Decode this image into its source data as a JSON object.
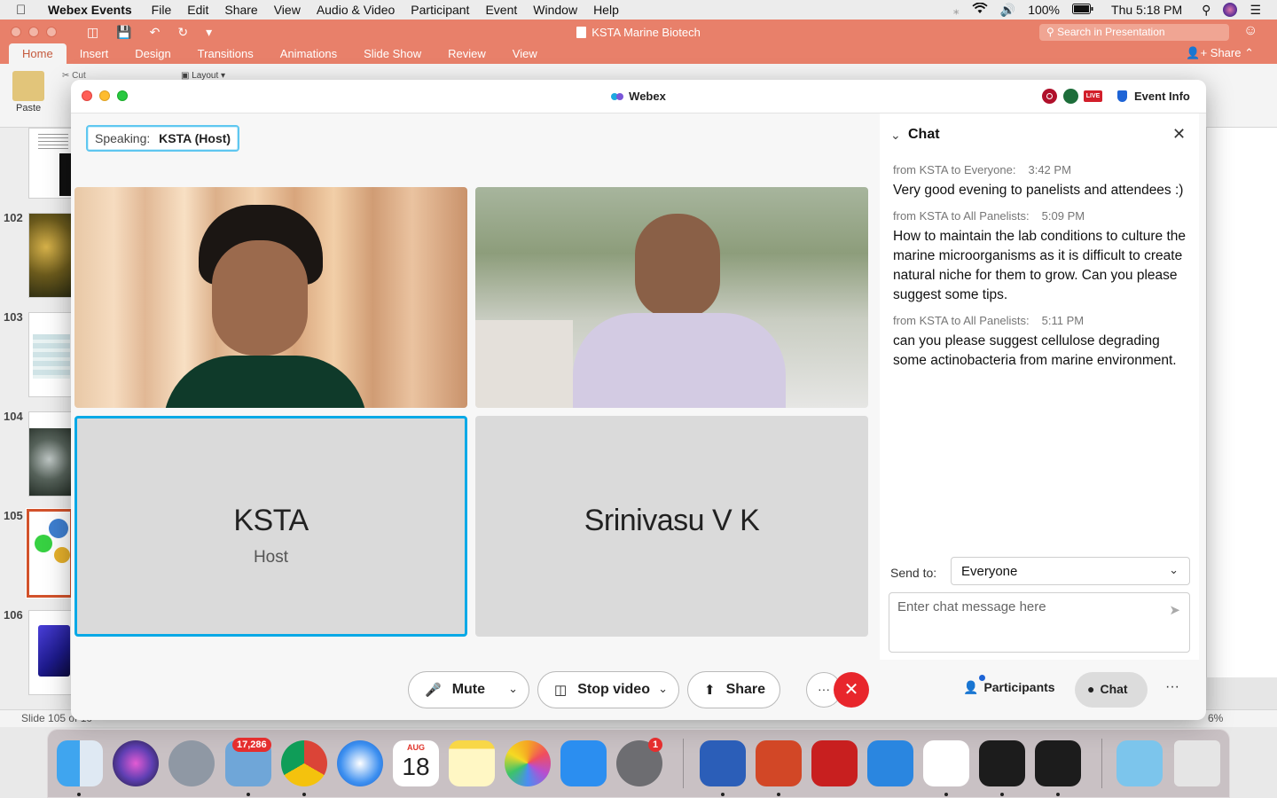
{
  "menubar": {
    "app_name": "Webex Events",
    "items": [
      "File",
      "Edit",
      "Share",
      "View",
      "Audio & Video",
      "Participant",
      "Event",
      "Window",
      "Help"
    ],
    "battery": "100%",
    "clock": "Thu 5:18 PM"
  },
  "powerpoint": {
    "document_title": "KSTA Marine Biotech",
    "search_placeholder": "Search in Presentation",
    "tabs": [
      "Home",
      "Insert",
      "Design",
      "Transitions",
      "Animations",
      "Slide Show",
      "Review",
      "View"
    ],
    "share_label": "Share",
    "paste_label": "Paste",
    "cut_label": "Cut",
    "layout_label": "Layout",
    "thumbnails": [
      "102",
      "103",
      "104",
      "105",
      "106"
    ],
    "selected_slide": "105",
    "status_slide": "Slide 105 of 10",
    "zoom": "6%"
  },
  "webex": {
    "window_title": "Webex",
    "live_label": "LIVE",
    "event_info_label": "Event Info",
    "speaking_label": "Speaking:",
    "speaking_name": "KSTA (Host)",
    "tiles": [
      {
        "name": "KSTA",
        "role": "Host"
      },
      {
        "name": "Srinivasu V K"
      }
    ],
    "controls": {
      "mute": "Mute",
      "stop_video": "Stop video",
      "share": "Share",
      "more": "···",
      "participants": "Participants",
      "chat": "Chat",
      "kebab": "···"
    },
    "chat": {
      "title": "Chat",
      "messages": [
        {
          "from": "from KSTA to Everyone:",
          "time": "3:42  PM",
          "text": "Very good evening to panelists and attendees :)"
        },
        {
          "from": "from KSTA to All Panelists:",
          "time": "5:09  PM",
          "text": "How to maintain the lab conditions to culture the marine microorganisms as it is difficult to create natural niche for them to grow. Can you please suggest some tips."
        },
        {
          "from": "from KSTA to All Panelists:",
          "time": "5:11  PM",
          "text": "can you please suggest cellulose degrading some actinobacteria from marine environment."
        }
      ],
      "send_to_label": "Send to:",
      "send_to_value": "Everyone",
      "input_placeholder": "Enter chat message here"
    }
  },
  "dock": {
    "mail_badge": "17,286",
    "calendar_month": "AUG",
    "calendar_day": "18",
    "settings_badge": "1"
  },
  "colors": {
    "ppt_accent": "#e8806a",
    "webex_active": "#07a9e6",
    "leave_red": "#e8262c"
  }
}
